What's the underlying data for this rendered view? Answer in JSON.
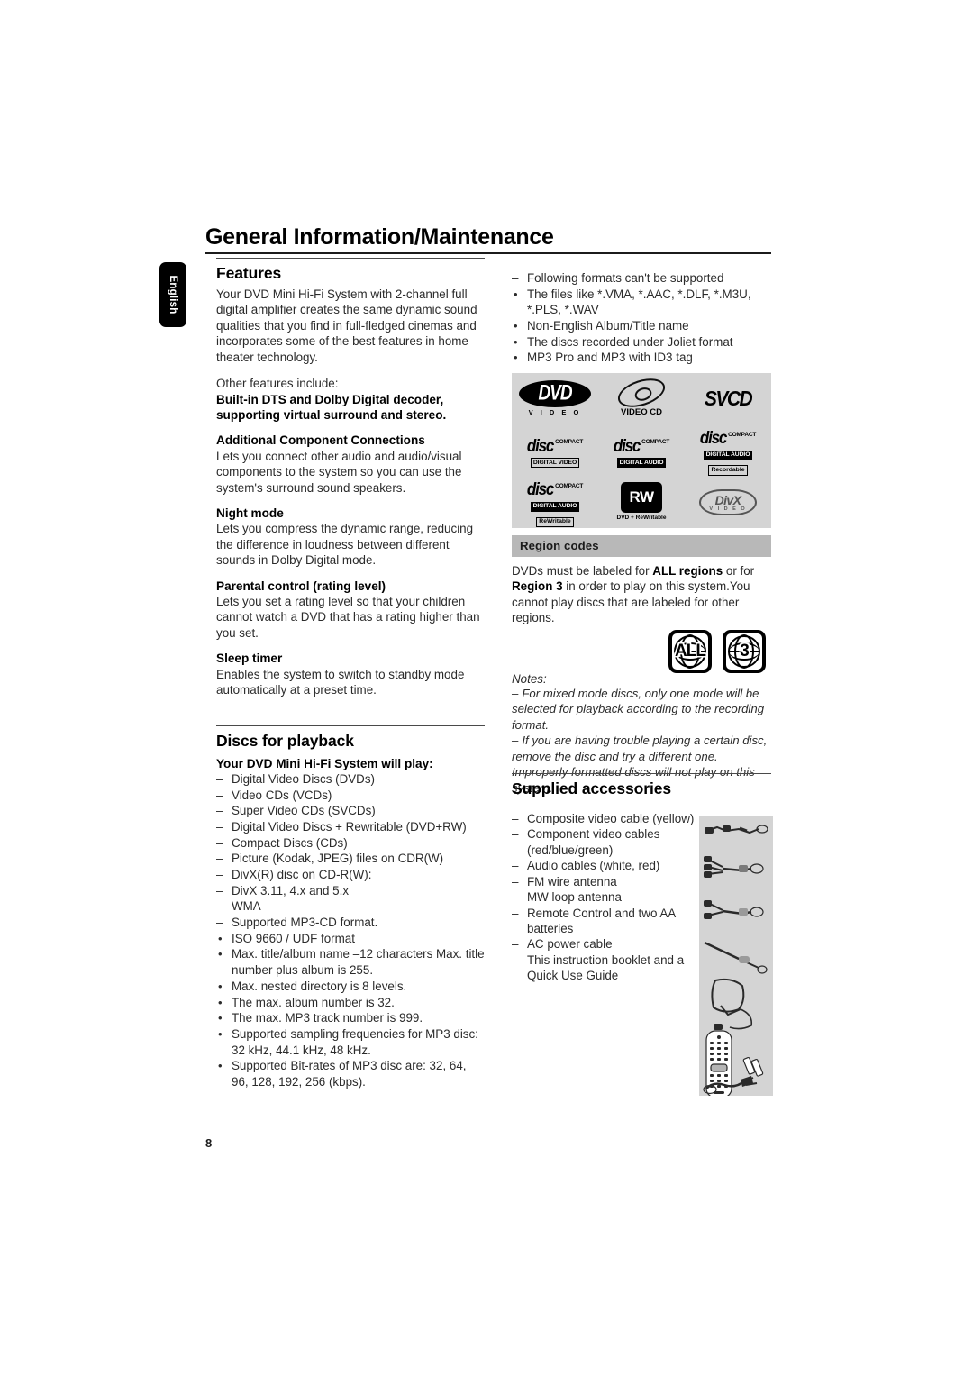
{
  "document": {
    "page_title": "General Information/Maintenance",
    "page_number": "8",
    "language_tab": "English"
  },
  "left_column": {
    "features": {
      "heading": "Features",
      "intro": "Your DVD Mini Hi-Fi System with 2-channel full digital amplifier creates the same dynamic sound qualities that you find in full-fledged cinemas and incorporates some of the best features in home theater technology.",
      "other_features_lead": "Other features include:",
      "bold_lead": "Built-in DTS and Dolby Digital decoder, supporting virtual surround and stereo.",
      "subsections": [
        {
          "title": "Additional Component Connections",
          "body": "Lets you connect other audio and audio/visual components to the system so you can use the system's surround sound speakers."
        },
        {
          "title": "Night mode",
          "body": "Lets you compress the dynamic range, reducing the difference in loudness between different sounds in Dolby Digital mode."
        },
        {
          "title": "Parental control (rating level)",
          "body": "Lets you set a rating level so that your children cannot watch a DVD that has a rating higher than you set."
        },
        {
          "title": "Sleep timer",
          "body": "Enables the system to switch to standby mode automatically at a preset time."
        }
      ]
    },
    "discs_for_playback": {
      "heading": "Discs for playback",
      "subheading": "Your DVD Mini Hi-Fi System will play:",
      "items": [
        {
          "marker": "–",
          "text": "Digital Video Discs (DVDs)"
        },
        {
          "marker": "–",
          "text": "Video CDs (VCDs)"
        },
        {
          "marker": "–",
          "text": "Super Video CDs (SVCDs)"
        },
        {
          "marker": "–",
          "text": "Digital Video Discs + Rewritable (DVD+RW)"
        },
        {
          "marker": "–",
          "text": "Compact Discs (CDs)"
        },
        {
          "marker": "–",
          "text": "Picture (Kodak, JPEG) files on CDR(W)"
        },
        {
          "marker": "–",
          "text": "DivX(R) disc on CD-R(W):"
        },
        {
          "marker": "–",
          "text": "DivX 3.11, 4.x and 5.x"
        },
        {
          "marker": "–",
          "text": "WMA"
        },
        {
          "marker": "–",
          "text": "Supported MP3-CD format."
        },
        {
          "marker": "•",
          "text": "ISO 9660 / UDF format"
        },
        {
          "marker": "•",
          "text": "Max. title/album name –12 characters Max. title number plus album is 255."
        },
        {
          "marker": "•",
          "text": "Max. nested directory is 8 levels."
        },
        {
          "marker": "•",
          "text": "The max. album number is 32."
        },
        {
          "marker": "•",
          "text": "The max. MP3 track number is 999."
        },
        {
          "marker": "•",
          "text": "Supported sampling frequencies for MP3 disc: 32 kHz, 44.1 kHz, 48 kHz."
        },
        {
          "marker": "•",
          "text": "Supported Bit-rates of MP3 disc are: 32, 64, 96, 128, 192, 256 (kbps)."
        }
      ]
    }
  },
  "right_column": {
    "unsupported": [
      {
        "marker": "–",
        "text": "Following formats can't be supported"
      },
      {
        "marker": "•",
        "text": "The files like *.VMA, *.AAC, *.DLF, *.M3U, *.PLS, *.WAV"
      },
      {
        "marker": "•",
        "text": "Non-English Album/Title name"
      },
      {
        "marker": "•",
        "text": "The discs recorded under Joliet format"
      },
      {
        "marker": "•",
        "text": "MP3 Pro and MP3 with ID3 tag"
      }
    ],
    "disc_logos": [
      {
        "name": "dvd-video-logo",
        "main": "DVD",
        "sub": "V I D E O"
      },
      {
        "name": "video-cd-logo",
        "main": "",
        "sub": "VIDEO CD"
      },
      {
        "name": "svcd-logo",
        "main": "SVCD",
        "sub": ""
      },
      {
        "name": "compact-disc-digital-video-logo",
        "compact": "COMPACT",
        "main": "disc",
        "band": "DIGITAL VIDEO"
      },
      {
        "name": "compact-disc-digital-audio-logo",
        "compact": "COMPACT",
        "main": "disc",
        "band": "DIGITAL AUDIO"
      },
      {
        "name": "compact-disc-recordable-logo",
        "compact": "COMPACT",
        "main": "disc",
        "band": "DIGITAL AUDIO",
        "band2": "Recordable"
      },
      {
        "name": "compact-disc-rewritable-logo",
        "compact": "COMPACT",
        "main": "disc",
        "band": "DIGITAL AUDIO",
        "band2": "ReWritable"
      },
      {
        "name": "dvd-plus-rewritable-logo",
        "main": "RW",
        "sub": "DVD + ReWritable"
      },
      {
        "name": "divx-video-logo",
        "main": "DivX",
        "sub": "V I D E O"
      }
    ],
    "region_codes": {
      "heading": "Region codes",
      "body_parts": [
        {
          "text": "DVDs must be labeled for ",
          "bold": false
        },
        {
          "text": "ALL regions",
          "bold": true
        },
        {
          "text": " or for ",
          "bold": false
        },
        {
          "text": "Region 3",
          "bold": true
        },
        {
          "text": " in order to play on this system.You cannot play discs that are labeled for other regions.",
          "bold": false
        }
      ],
      "icons": [
        {
          "name": "region-all-icon",
          "label": "ALL"
        },
        {
          "name": "region-3-icon",
          "label": "3"
        }
      ]
    },
    "notes": {
      "label": "Notes:",
      "items": [
        {
          "marker": "–",
          "text": "For mixed mode discs, only one mode will be selected for playback according to the recording format."
        },
        {
          "marker": "–",
          "text": "If you are having trouble playing a certain disc, remove the disc and try a different one. Improperly formatted discs will not play on this system."
        }
      ]
    },
    "supplied_accessories": {
      "heading": "Supplied accessories",
      "items": [
        {
          "marker": "–",
          "text": "Composite video cable (yellow)"
        },
        {
          "marker": "–",
          "text": "Component video cables (red/blue/green)"
        },
        {
          "marker": "–",
          "text": "Audio cables (white, red)"
        },
        {
          "marker": "–",
          "text": "FM wire antenna"
        },
        {
          "marker": "–",
          "text": "MW loop antenna"
        },
        {
          "marker": "–",
          "text": "Remote Control and two AA batteries"
        },
        {
          "marker": "–",
          "text": "AC power cable"
        },
        {
          "marker": "–",
          "text": "This instruction booklet and a Quick Use Guide"
        }
      ]
    }
  },
  "colors": {
    "text": "#2b2b2b",
    "heading": "#000000",
    "panel_gray": "#d4d4d4",
    "band_gray": "#b8b8b8",
    "tab_black": "#000000"
  }
}
